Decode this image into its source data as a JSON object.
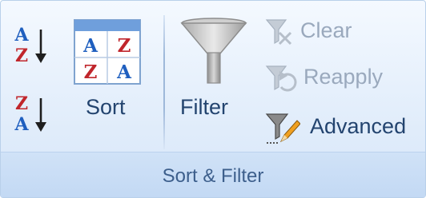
{
  "group": {
    "label": "Sort & Filter"
  },
  "sort_az": {
    "top_letter": "A",
    "bottom_letter": "Z"
  },
  "sort_za": {
    "top_letter": "Z",
    "bottom_letter": "A"
  },
  "sort": {
    "label": "Sort",
    "icon_letters": {
      "top_left": "A",
      "top_right": "Z",
      "bottom_left": "Z",
      "bottom_right": "A"
    }
  },
  "filter": {
    "label": "Filter"
  },
  "clear": {
    "label": "Clear",
    "enabled": false
  },
  "reapply": {
    "label": "Reapply",
    "enabled": false
  },
  "advanced": {
    "label": "Advanced",
    "enabled": true
  },
  "colors": {
    "accent_blue": "#1f5fbf",
    "accent_red": "#c0262c",
    "label_text": "#23446f",
    "disabled_text": "#9aa9bd",
    "group_label": "#3d5f8c"
  }
}
